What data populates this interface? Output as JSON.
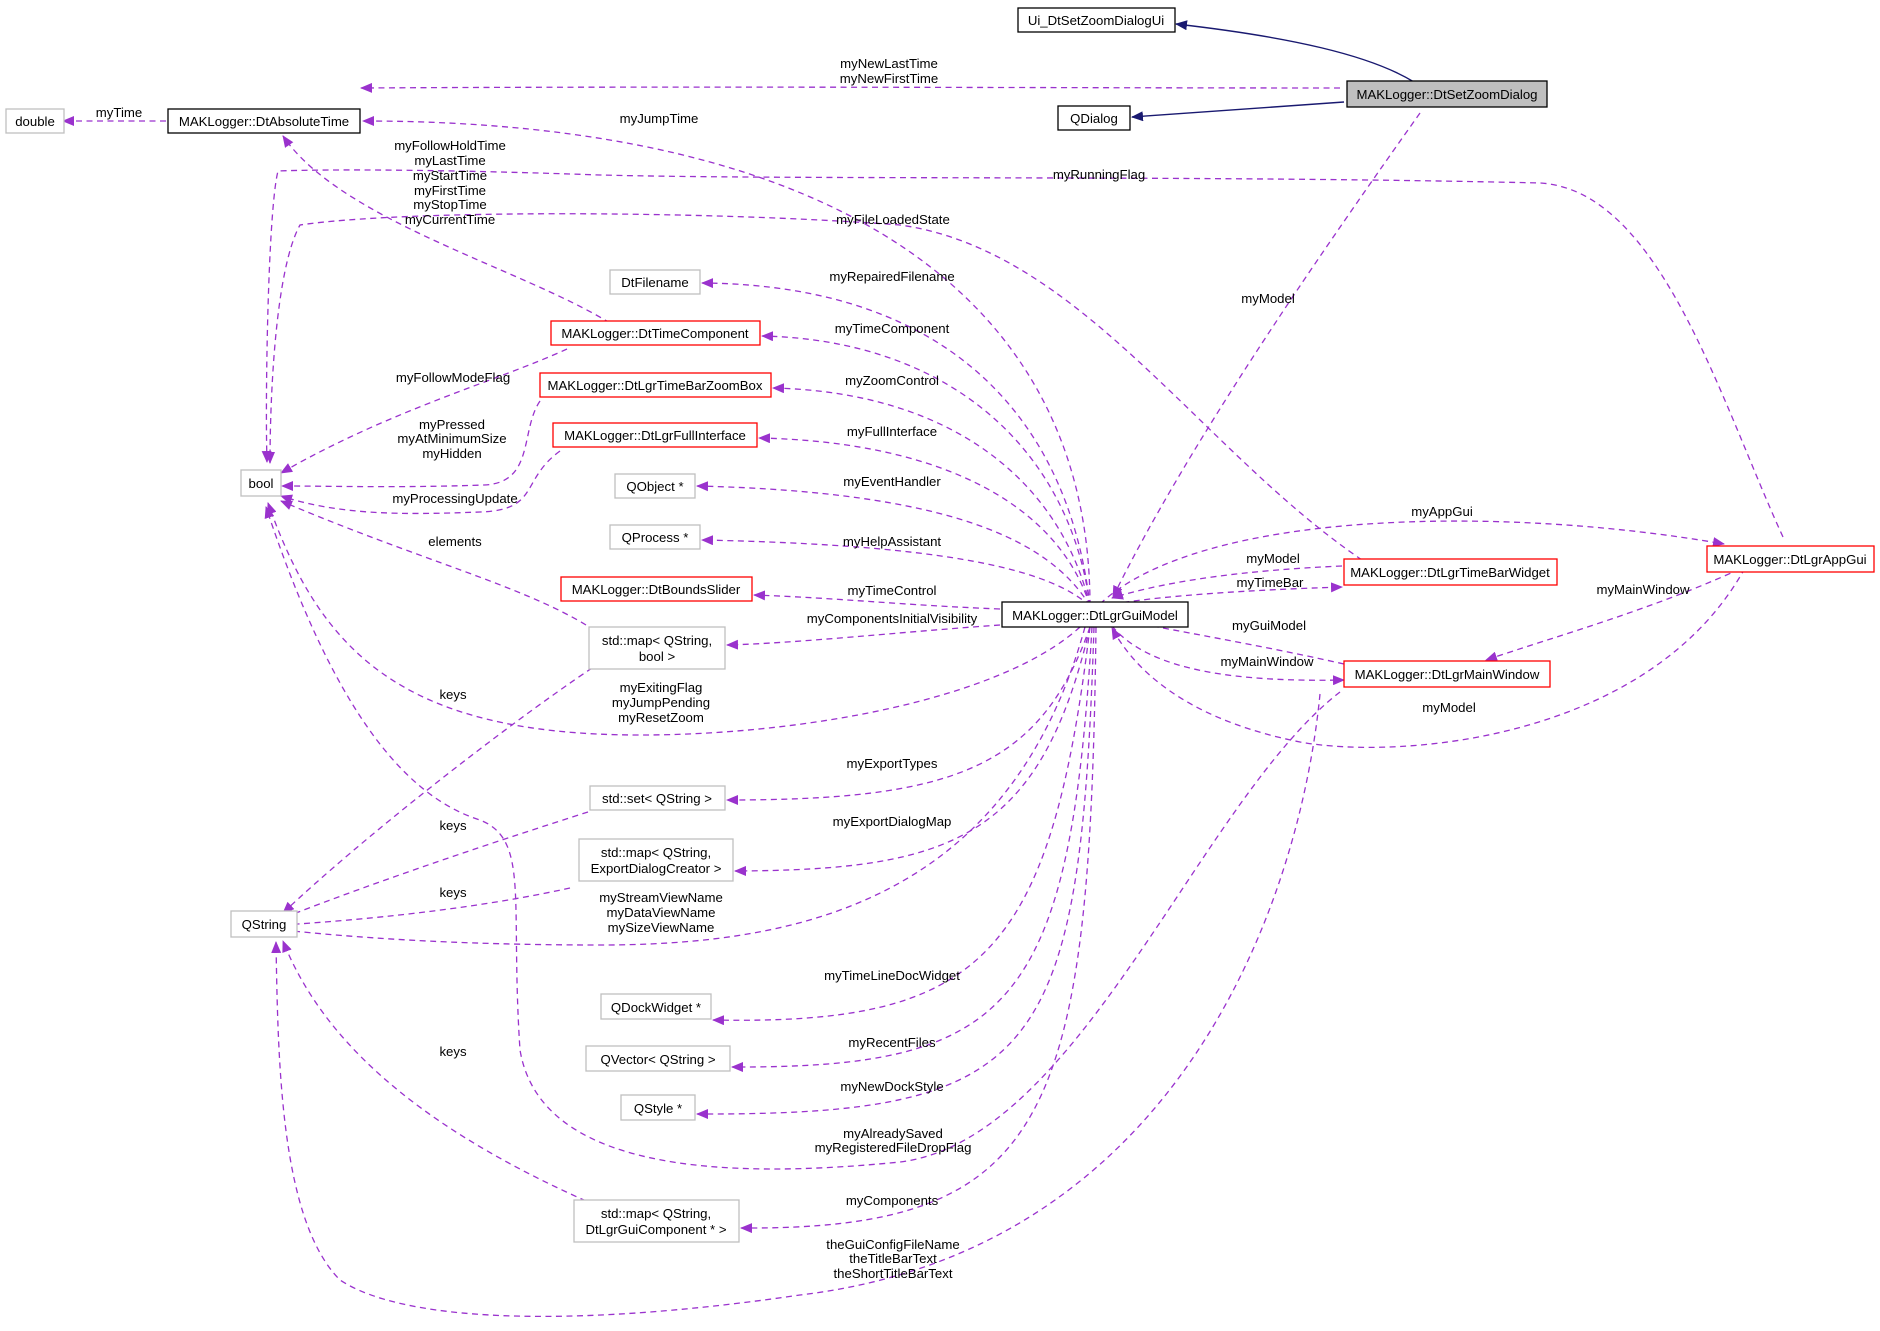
{
  "colors": {
    "dependency_edge": "#9a32cd",
    "inheritance_edge": "#191970",
    "node_normal_border": "#000000",
    "node_truncated_border": "#ff0000",
    "node_external_border": "#bfbfbf",
    "focus_node_fill": "#bfbfbf"
  },
  "nodes": {
    "ui_zoom": "Ui_DtSetZoomDialogUi",
    "set_zoom": "MAKLogger::DtSetZoomDialog",
    "qdialog": "QDialog",
    "double": "double",
    "abs_time": "MAKLogger::DtAbsoluteTime",
    "filename": "DtFilename",
    "time_comp": "MAKLogger::DtTimeComponent",
    "zoom_box": "MAKLogger::DtLgrTimeBarZoomBox",
    "full_iface": "MAKLogger::DtLgrFullInterface",
    "bool": "bool",
    "qobject": "QObject *",
    "qprocess": "QProcess *",
    "bounds": "MAKLogger::DtBoundsSlider",
    "gui_model": "MAKLogger::DtLgrGuiModel",
    "map_bool_1": "std::map< QString,",
    "map_bool_2": "bool >",
    "set_qstr": "std::set< QString >",
    "map_exp_1": "std::map< QString,",
    "map_exp_2": "ExportDialogCreator >",
    "qstring": "QString",
    "qdock": "QDockWidget *",
    "qvector": "QVector< QString >",
    "qstyle": "QStyle *",
    "map_comp_1": "std::map< QString,",
    "map_comp_2": "DtLgrGuiComponent * >",
    "timebar_widget": "MAKLogger::DtLgrTimeBarWidget",
    "main_window": "MAKLogger::DtLgrMainWindow",
    "app_gui": "MAKLogger::DtLgrAppGui"
  },
  "edge_labels": {
    "new_last_time": "myNewLastTime",
    "new_first_time": "myNewFirstTime",
    "my_time": "myTime",
    "jump_time": "myJumpTime",
    "follow_hold": "myFollowHoldTime",
    "last_time": "myLastTime",
    "start_time": "myStartTime",
    "first_time": "myFirstTime",
    "stop_time": "myStopTime",
    "current_time": "myCurrentTime",
    "running_flag": "myRunningFlag",
    "file_loaded": "myFileLoadedState",
    "model_top": "myModel",
    "repaired": "myRepairedFilename",
    "time_component": "myTimeComponent",
    "follow_mode": "myFollowModeFlag",
    "zoom_control": "myZoomControl",
    "pressed": "myPressed",
    "at_min_size": "myAtMinimumSize",
    "hidden": "myHidden",
    "full_interface": "myFullInterface",
    "processing": "myProcessingUpdate",
    "event_handler": "myEventHandler",
    "elements": "elements",
    "help_assistant": "myHelpAssistant",
    "app_gui": "myAppGui",
    "model_tb": "myModel",
    "time_bar": "myTimeBar",
    "time_control": "myTimeControl",
    "comp_init_vis": "myComponentsInitialVisibility",
    "main_window_ag": "myMainWindow",
    "gui_model": "myGuiModel",
    "main_window_mw": "myMainWindow",
    "keys_1": "keys",
    "exiting": "myExitingFlag",
    "jump_pending": "myJumpPending",
    "reset_zoom": "myResetZoom",
    "model_ag": "myModel",
    "export_types": "myExportTypes",
    "keys_2": "keys",
    "export_dialog_map": "myExportDialogMap",
    "keys_3": "keys",
    "stream_view": "myStreamViewName",
    "data_view": "myDataViewName",
    "size_view": "mySizeViewName",
    "timeline_doc": "myTimeLineDocWidget",
    "recent_files": "myRecentFiles",
    "keys_4": "keys",
    "new_dock_style": "myNewDockStyle",
    "already_saved": "myAlreadySaved",
    "registered_drop": "myRegisteredFileDropFlag",
    "components": "myComponents",
    "gui_config": "theGuiConfigFileName",
    "title_bar": "theTitleBarText",
    "short_title": "theShortTitleBarText"
  }
}
